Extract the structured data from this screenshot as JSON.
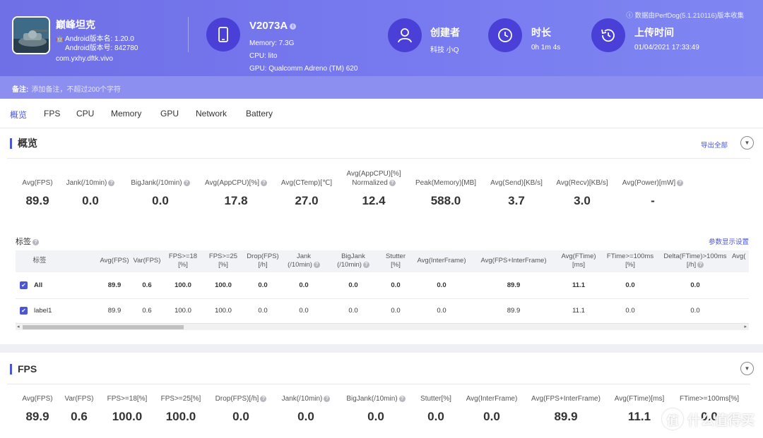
{
  "header": {
    "app": {
      "name": "巅峰坦克",
      "version_name": "Android版本名: 1.20.0",
      "version_code": "Android版本号: 842780",
      "package": "com.yxhy.dftk.vivo"
    },
    "device": {
      "name": "V2073A",
      "info_icon": "i",
      "memory": "Memory: 7.3G",
      "cpu": "CPU: lito",
      "gpu": "GPU: Qualcomm Adreno (TM) 620"
    },
    "creator": {
      "title": "创建者",
      "value": "科技 小Q"
    },
    "duration": {
      "title": "时长",
      "value": "0h 1m 4s"
    },
    "upload": {
      "title": "上传时间",
      "value": "01/04/2021 17:33:49"
    },
    "version_note": "ⓘ 数据由PerfDog(5.1.210116)版本收集"
  },
  "notice": {
    "label": "备注:",
    "placeholder": "添加备注，不超过200个字符"
  },
  "tabs": [
    "概览",
    "FPS",
    "CPU",
    "Memory",
    "GPU",
    "Network",
    "Battery"
  ],
  "overview": {
    "title": "概览",
    "export_label": "导出全部",
    "metrics": [
      {
        "label": "Avg(FPS)",
        "value": "89.9"
      },
      {
        "label": "Jank(/10min)",
        "value": "0.0"
      },
      {
        "label": "BigJank(/10min)",
        "value": "0.0"
      },
      {
        "label": "Avg(AppCPU)[%]",
        "value": "17.8"
      },
      {
        "label": "Avg(CTemp)[℃]",
        "value": "27.0"
      },
      {
        "label": "Avg(AppCPU)[%]",
        "label2": "Normalized",
        "value": "12.4"
      },
      {
        "label": "Peak(Memory)[MB]",
        "value": "588.0"
      },
      {
        "label": "Avg(Send)[KB/s]",
        "value": "3.7"
      },
      {
        "label": "Avg(Recv)[KB/s]",
        "value": "3.0"
      },
      {
        "label": "Avg(Power)[mW]",
        "value": "-"
      }
    ],
    "tag_title": "标签",
    "param_link": "参数显示设置",
    "table": {
      "headers": [
        [
          "标签"
        ],
        [
          "Avg(FPS)"
        ],
        [
          "Var(FPS)"
        ],
        [
          "FPS>=18",
          "[%]"
        ],
        [
          "FPS>=25",
          "[%]"
        ],
        [
          "Drop(FPS)",
          "[/h]"
        ],
        [
          "Jank",
          "(/10min)"
        ],
        [
          "BigJank",
          "(/10min)"
        ],
        [
          "Stutter",
          "[%]"
        ],
        [
          "Avg(InterFrame)"
        ],
        [
          "Avg(FPS+InterFrame)"
        ],
        [
          "Avg(FTime)",
          "[ms]"
        ],
        [
          "FTime>=100ms",
          "[%]"
        ],
        [
          "Delta(FTime)>100ms",
          "[/h]"
        ],
        [
          "Avg("
        ]
      ],
      "rows": [
        {
          "cells": [
            "All",
            "89.9",
            "0.6",
            "100.0",
            "100.0",
            "0.0",
            "0.0",
            "0.0",
            "0.0",
            "0.0",
            "89.9",
            "11.1",
            "0.0",
            "0.0",
            ""
          ]
        },
        {
          "cells": [
            "label1",
            "89.9",
            "0.6",
            "100.0",
            "100.0",
            "0.0",
            "0.0",
            "0.0",
            "0.0",
            "0.0",
            "89.9",
            "11.1",
            "0.0",
            "0.0",
            ""
          ]
        }
      ]
    }
  },
  "fps": {
    "title": "FPS",
    "metrics": [
      {
        "label": "Avg(FPS)",
        "value": "89.9"
      },
      {
        "label": "Var(FPS)",
        "value": "0.6"
      },
      {
        "label": "FPS>=18[%]",
        "value": "100.0"
      },
      {
        "label": "FPS>=25[%]",
        "value": "100.0"
      },
      {
        "label": "Drop(FPS)[/h]",
        "value": "0.0"
      },
      {
        "label": "Jank(/10min)",
        "value": "0.0"
      },
      {
        "label": "BigJank(/10min)",
        "value": "0.0"
      },
      {
        "label": "Stutter[%]",
        "value": "0.0"
      },
      {
        "label": "Avg(InterFrame)",
        "value": "0.0"
      },
      {
        "label": "Avg(FPS+InterFrame)",
        "value": "89.9"
      },
      {
        "label": "Avg(FTime)[ms]",
        "value": "11.1"
      },
      {
        "label": "FTime>=100ms[%]",
        "value": "0.0"
      }
    ]
  },
  "watermark": {
    "glyph": "值",
    "text": "什么值得买"
  },
  "colors": {
    "accent": "#4b55d6",
    "header": "#7678ee",
    "circle": "#4a40d8"
  }
}
